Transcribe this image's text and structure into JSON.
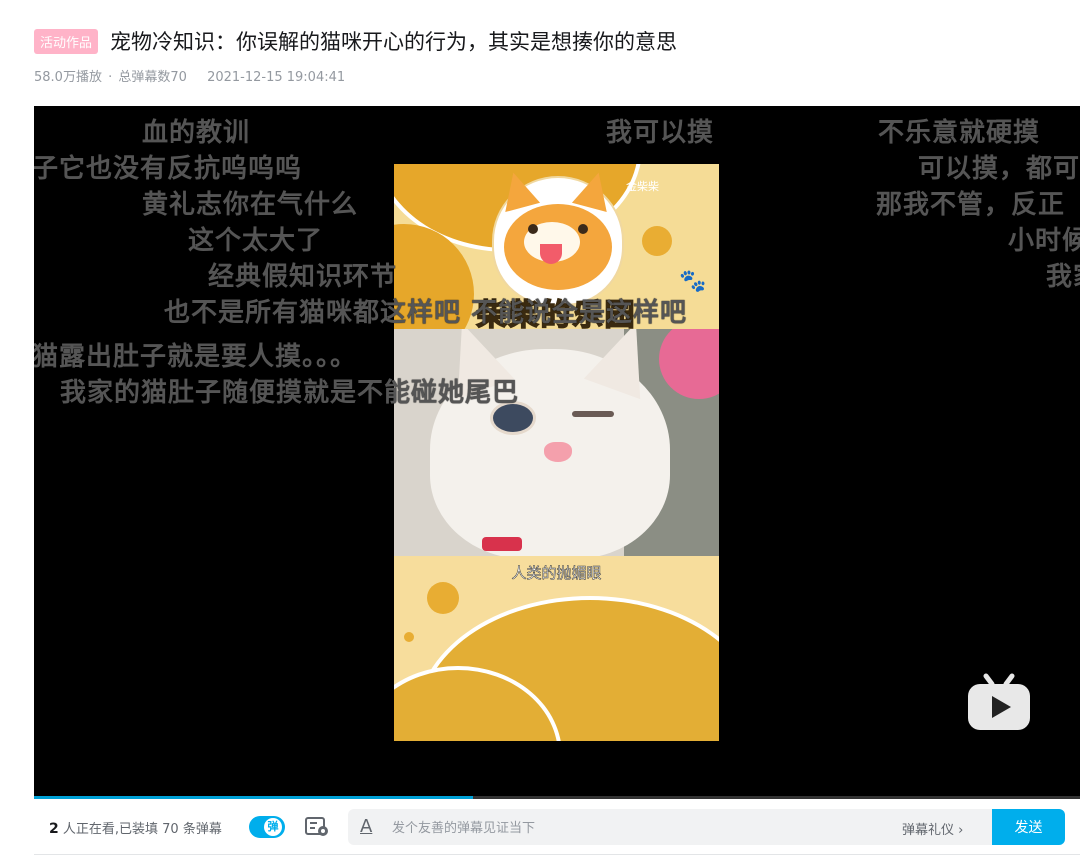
{
  "header": {
    "badge": "活动作品",
    "title": "宠物冷知识：你误解的猫咪开心的行为，其实是想揍你的意思"
  },
  "meta": {
    "plays": "58.0万播放",
    "separator": "·",
    "danmaku_total": "总弹幕数70",
    "date": "2021-12-15 19:04:41"
  },
  "player": {
    "progress_fraction": 0.42,
    "danmaku": [
      "血的教训",
      "子它也没有反抗呜呜呜",
      "黄礼志你在气什么",
      "这个太大了",
      "经典假知识环节",
      "也不是所有猫咪都这样吧 不能说全是这样吧",
      "猫露出肚子就是要人摸。。。",
      "我家的猫肚子随便摸就是不能碰她尾巴",
      "我可以摸",
      "不乐意就硬摸",
      "可以摸，都可",
      "那我不管，反正",
      "小时候",
      "我家"
    ],
    "video": {
      "watermark": "金柴柴",
      "caption_top": "柴柴的乐园",
      "caption_mid": "人类的抛媚眼"
    }
  },
  "bottom_bar": {
    "viewer_count": "2",
    "viewer_text": "人正在看,已装填 70 条弹幕",
    "toggle_label": "弹",
    "input_placeholder": "发个友善的弹幕见证当下",
    "etiquette": "弹幕礼仪 ›",
    "send_label": "发送"
  }
}
